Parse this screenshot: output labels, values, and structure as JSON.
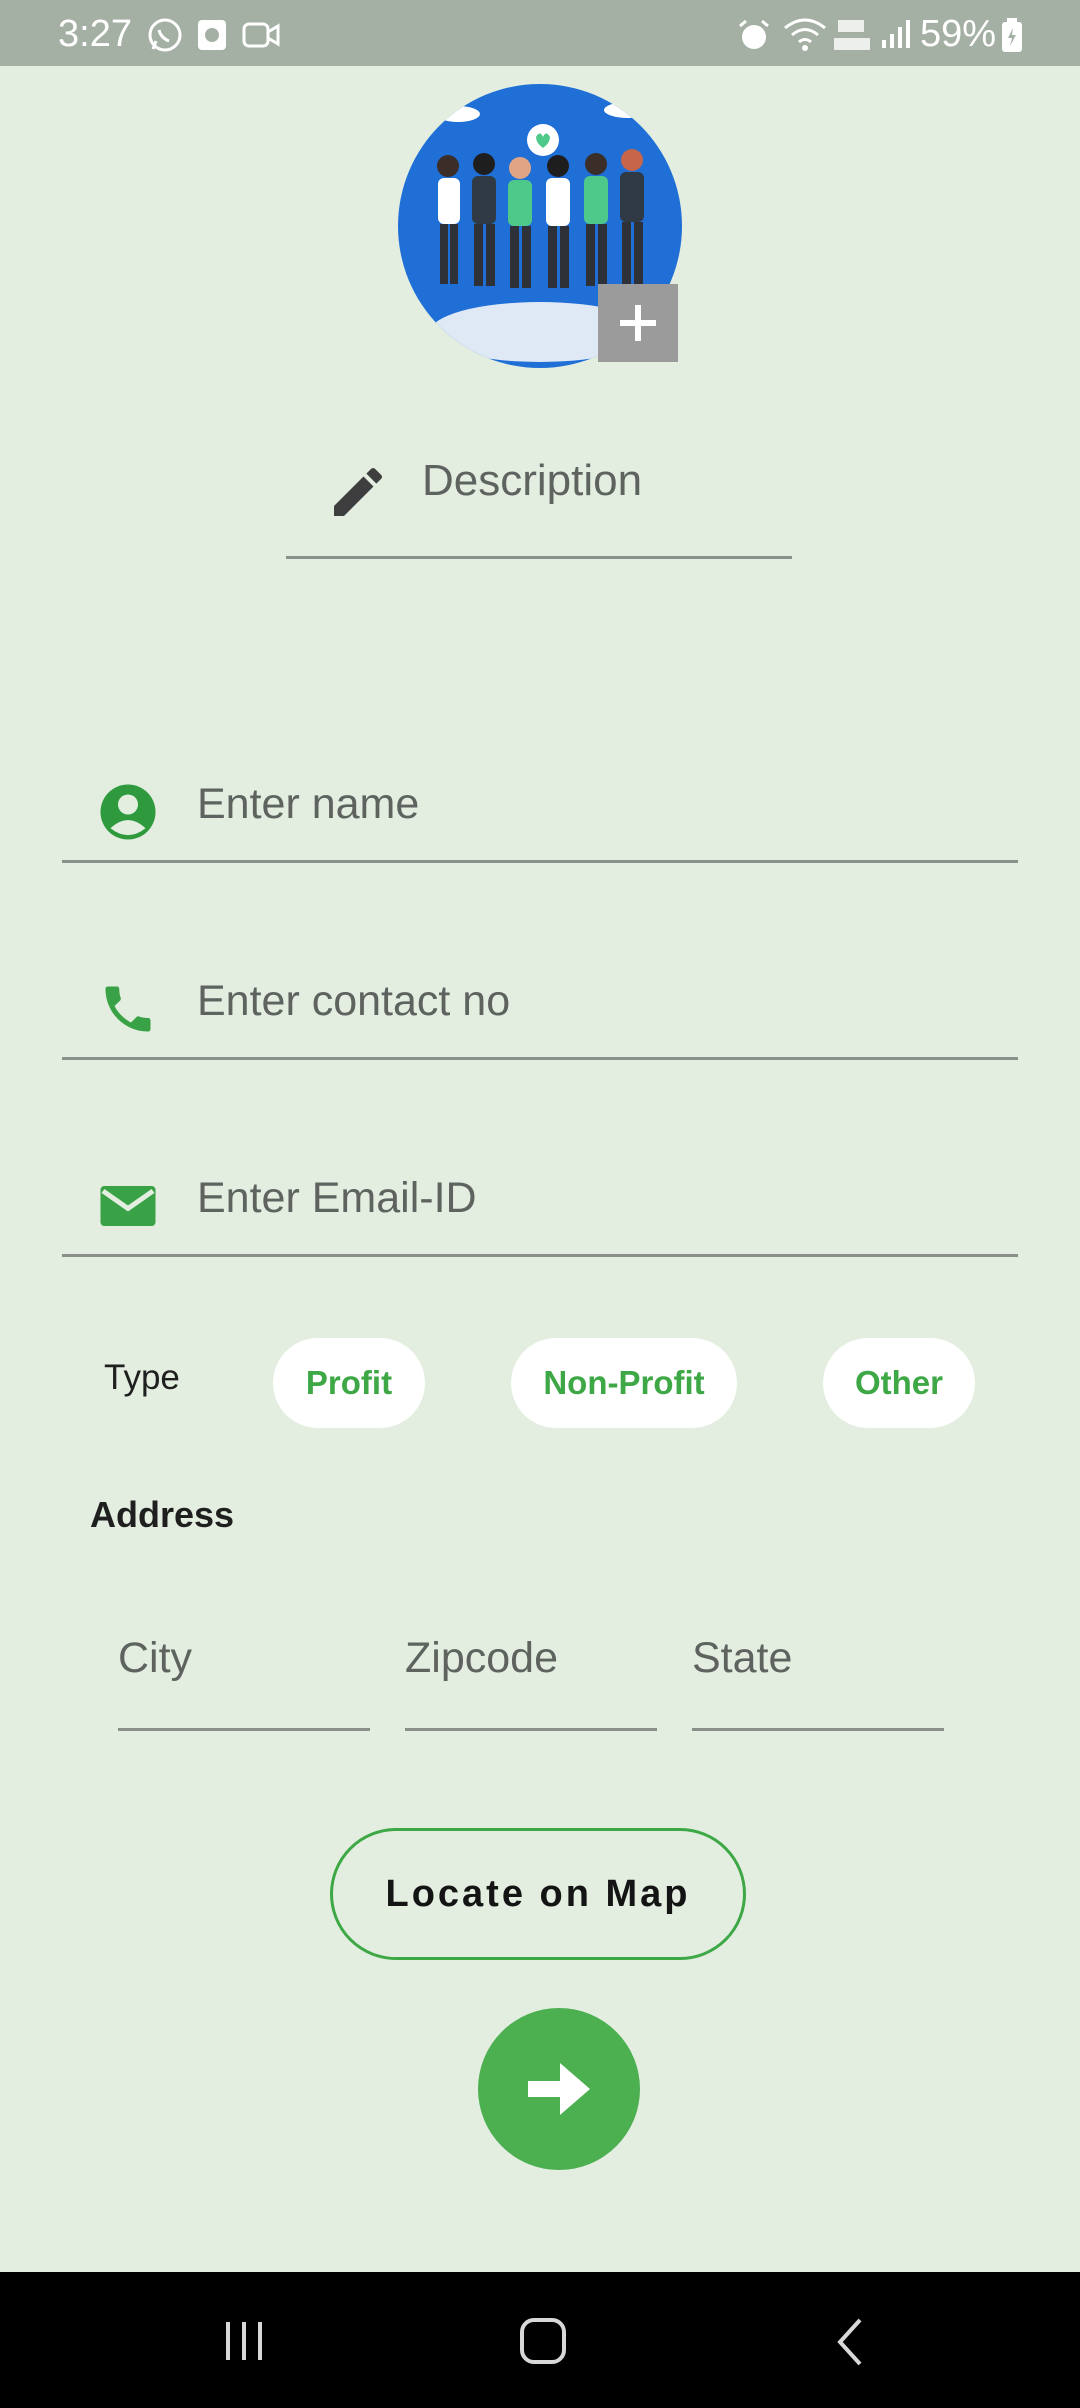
{
  "status_bar": {
    "time": "3:27",
    "battery": "59%"
  },
  "description_field": {
    "placeholder": "Description"
  },
  "form": {
    "name_placeholder": "Enter name",
    "contact_placeholder": "Enter contact no",
    "email_placeholder": "Enter Email-ID"
  },
  "type": {
    "label": "Type",
    "options": [
      "Profit",
      "Non-Profit",
      "Other"
    ]
  },
  "address": {
    "label": "Address",
    "city_placeholder": "City",
    "zipcode_placeholder": "Zipcode",
    "state_placeholder": "State"
  },
  "locate_button_label": "Locate on Map",
  "colors": {
    "accent": "#4caf50",
    "background": "#e3eee0",
    "status_bar": "#a5b0a5"
  }
}
